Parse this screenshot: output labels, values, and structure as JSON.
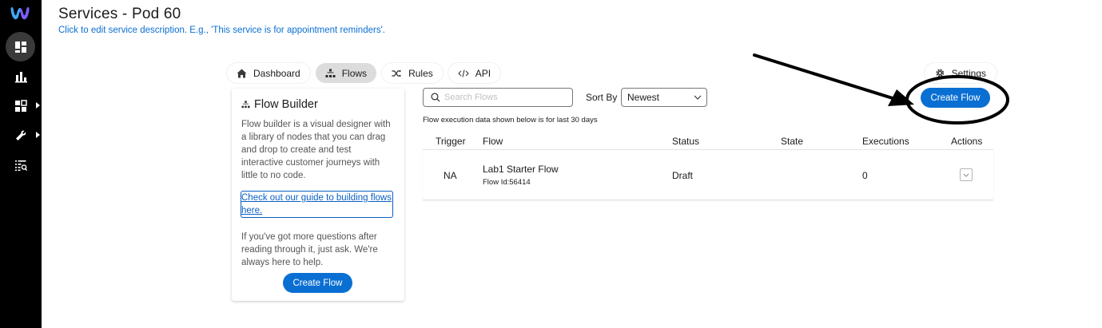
{
  "sidebar": {
    "logo": "webex-logo-icon",
    "items": [
      {
        "icon": "dashboard-icon",
        "active": true
      },
      {
        "icon": "bar-chart-icon",
        "active": false
      },
      {
        "icon": "grid-icon",
        "active": false,
        "has_submenu": true
      },
      {
        "icon": "wrench-icon",
        "active": false,
        "has_submenu": true
      },
      {
        "icon": "list-search-icon",
        "active": false
      }
    ]
  },
  "header": {
    "title": "Services - Pod 60",
    "description": "Click to edit service description. E.g., 'This service is for appointment reminders'."
  },
  "tabs": [
    {
      "label": "Dashboard",
      "icon": "home-icon",
      "active": false
    },
    {
      "label": "Flows",
      "icon": "flow-tree-icon",
      "active": true
    },
    {
      "label": "Rules",
      "icon": "shuffle-icon",
      "active": false
    },
    {
      "label": "API",
      "icon": "code-icon",
      "active": false
    }
  ],
  "settings": {
    "label": "Settings",
    "icon": "gear-icon"
  },
  "flow_builder_card": {
    "title": "Flow Builder",
    "description": "Flow builder is a visual designer with a library of nodes that you can drag and drop to create and test interactive customer journeys with little to no code.",
    "link_text": "Check out our guide to building flows here.",
    "help_text": "If you've got more questions after reading through it, just ask. We're always here to help.",
    "button_label": "Create Flow"
  },
  "toolbar": {
    "search_placeholder": "Search Flows",
    "sort_label": "Sort By",
    "sort_value": "Newest",
    "create_button_label": "Create Flow"
  },
  "execution_note": "Flow execution data shown below is for last 30 days",
  "table": {
    "columns": [
      "Trigger",
      "Flow",
      "Status",
      "State",
      "Executions",
      "Actions"
    ],
    "rows": [
      {
        "trigger": "NA",
        "flow_name": "Lab1 Starter Flow",
        "flow_id": "Flow Id:56414",
        "status": "Draft",
        "state": "",
        "executions": "0"
      }
    ]
  },
  "colors": {
    "sidebar_bg": "#000000",
    "accent": "#0a6fd3",
    "link": "#0a5fc4",
    "active_tab": "#dcdcdc"
  },
  "annotation": {
    "type": "arrow-and-ellipse",
    "target": "create-flow-button"
  }
}
